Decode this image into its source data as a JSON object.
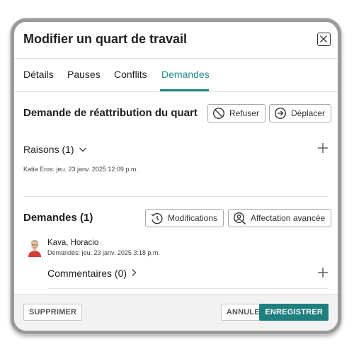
{
  "dialog": {
    "title": "Modifier un quart de travail"
  },
  "tabs": [
    {
      "label": "Détails",
      "active": false
    },
    {
      "label": "Pauses",
      "active": false
    },
    {
      "label": "Conflits",
      "active": false
    },
    {
      "label": "Demandes",
      "active": true
    }
  ],
  "reassignment": {
    "title": "Demande de réattribution du quart",
    "refuse_label": "Refuser",
    "move_label": "Déplacer",
    "reasons_label": "Raisons (1)",
    "reason_entry": "Katia Eros: jeu. 23 janv. 2025 12:09 p.m."
  },
  "requests": {
    "title": "Demandes (1)",
    "modifications_label": "Modifications",
    "advanced_label": "Affectation avancée",
    "items": [
      {
        "name": "Kava, Horacio",
        "requested": "Demandés: jeu. 23 janv. 2025 3:18 p.m.",
        "comments_label": "Commentaires (0)"
      }
    ]
  },
  "footer": {
    "delete_label": "SUPPRIMER",
    "cancel_label": "ANNULER",
    "save_label": "ENREGISTRER"
  },
  "colors": {
    "accent": "#1f8a8a",
    "save_button": "#1f7f7f"
  },
  "icons": {
    "close": "close-icon",
    "refuse": "prohibited-icon",
    "move": "arrow-circle-right-icon",
    "reasons_toggle": "chevron-down-icon",
    "modifications": "history-icon",
    "advanced": "user-search-icon",
    "comments_toggle": "chevron-right-icon",
    "add": "plus-icon"
  }
}
